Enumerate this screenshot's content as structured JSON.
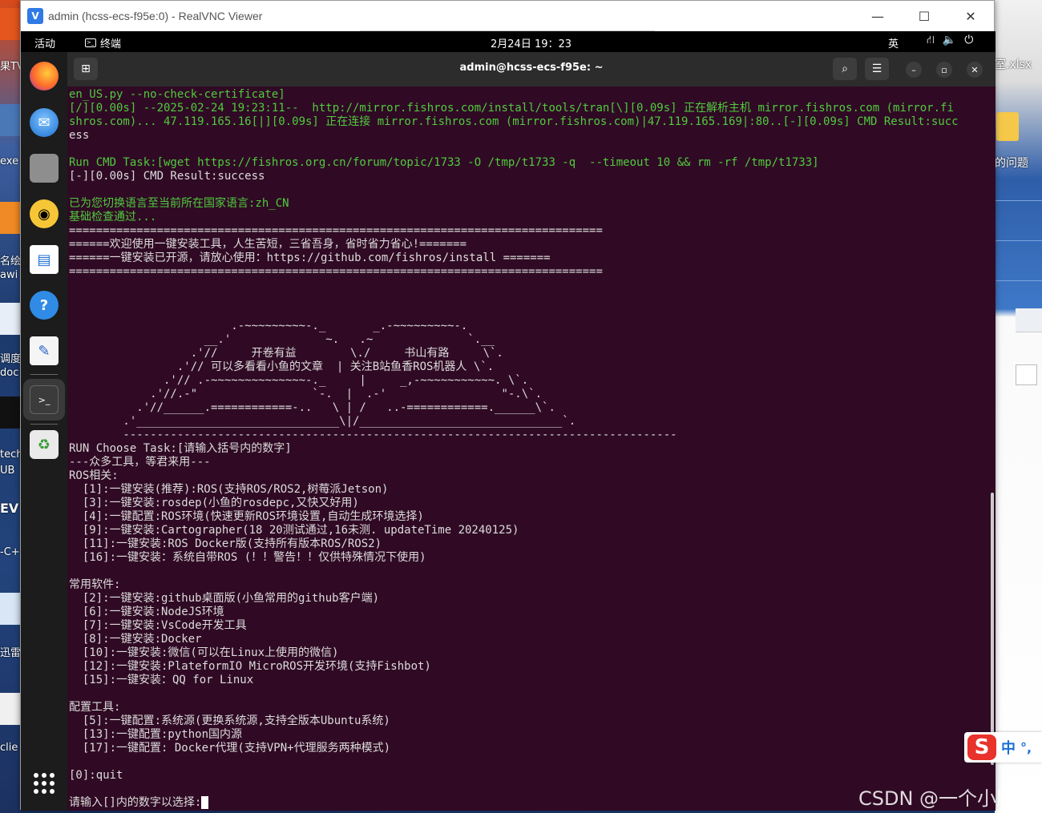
{
  "window": {
    "title": "admin (hcss-ecs-f95e:0) - RealVNC Viewer",
    "logo_letter": "V"
  },
  "desktop": {
    "left_labels": [
      "果TV",
      "exe",
      "名绘",
      "awi",
      "调度",
      "doc",
      "tech",
      "UB",
      "EV",
      "-C+",
      "迅雷",
      "clie"
    ],
    "right_labels": [
      "室.xlsx",
      "的问题"
    ],
    "ime": {
      "logo": "S",
      "mode": "中",
      "punct": "°,"
    },
    "watermark": "CSDN @一个小脑袋"
  },
  "topbar": {
    "activities": "活动",
    "app": "终端",
    "clock": "2月24日  19：23",
    "lang": "英",
    "icons": [
      "network-icon",
      "volume-icon",
      "power-icon"
    ]
  },
  "terminal": {
    "title": "admin@hcss-ecs-f95e: ~",
    "lines": [
      {
        "t": "en_US.py --no-check-certificate]",
        "c": "g"
      },
      {
        "t": "[/][0.00s] --2025-02-24 19:23:11--  http://mirror.fishros.com/install/tools/tran[\\][0.09s] 正在解析主机 mirror.fishros.com (mirror.fi",
        "c": "g"
      },
      {
        "t": "shros.com)... 47.119.165.16[|][0.09s] 正在连接 mirror.fishros.com (mirror.fishros.com)|47.119.165.169|:80..[-][0.09s] CMD Result:succ",
        "c": "g"
      },
      {
        "t": "ess",
        "c": ""
      },
      {
        "t": "",
        "c": ""
      },
      {
        "t": "Run CMD Task:[wget https://fishros.org.cn/forum/topic/1733 -O /tmp/t1733 -q  --timeout 10 && rm -rf /tmp/t1733]",
        "c": "g"
      },
      {
        "t": "[-][0.00s] CMD Result:success",
        "c": ""
      },
      {
        "t": "",
        "c": ""
      },
      {
        "t": "已为您切换语言至当前所在国家语言:zh_CN",
        "c": "g"
      },
      {
        "t": "基础检查通过...",
        "c": "g"
      },
      {
        "t": "===============================================================================",
        "c": ""
      },
      {
        "t": "======欢迎使用一键安装工具，人生苦短，三省吾身，省时省力省心!=======",
        "c": ""
      },
      {
        "t": "======一键安装已开源，请放心使用：https://github.com/fishros/install =======",
        "c": ""
      },
      {
        "t": "===============================================================================",
        "c": ""
      },
      {
        "t": "",
        "c": ""
      },
      {
        "t": "",
        "c": ""
      },
      {
        "t": "",
        "c": ""
      },
      {
        "t": "                        .-~~~~~~~~~-._       _.-~~~~~~~~~-.",
        "c": ""
      },
      {
        "t": "                    __.'              ~.   .~              `.__",
        "c": ""
      },
      {
        "t": "                  .'//     开卷有益        \\./     书山有路     \\`.",
        "c": ""
      },
      {
        "t": "                .'// 可以多看看小鱼的文章  | 关注B站鱼香ROS机器人 \\`.",
        "c": ""
      },
      {
        "t": "              .'// .-~~~~~~~~~~~~~~-._     |     _,-~~~~~~~~~~~. \\`.",
        "c": ""
      },
      {
        "t": "            .'//.-\"                 `-.  |  .-'                 \"-.\\`.",
        "c": ""
      },
      {
        "t": "          .'//______.============-..   \\ | /   ..-============.______\\`.",
        "c": ""
      },
      {
        "t": "        .'______________________________\\|/______________________________`.",
        "c": ""
      },
      {
        "t": "        ----------------------------------------------------------------------------------",
        "c": ""
      },
      {
        "t": "RUN Choose Task:[请输入括号内的数字]",
        "c": ""
      },
      {
        "t": "---众多工具，等君来用---",
        "c": ""
      },
      {
        "t": "ROS相关:",
        "c": ""
      },
      {
        "t": "  [1]:一键安装(推荐):ROS(支持ROS/ROS2,树莓派Jetson)",
        "c": ""
      },
      {
        "t": "  [3]:一键安装:rosdep(小鱼的rosdepc,又快又好用)",
        "c": ""
      },
      {
        "t": "  [4]:一键配置:ROS环境(快速更新ROS环境设置,自动生成环境选择)",
        "c": ""
      },
      {
        "t": "  [9]:一键安装:Cartographer(18 20测试通过,16未测. updateTime 20240125)",
        "c": ""
      },
      {
        "t": "  [11]:一键安装:ROS Docker版(支持所有版本ROS/ROS2)",
        "c": ""
      },
      {
        "t": "  [16]:一键安装：系统自带ROS (！！警告！！仅供特殊情况下使用)",
        "c": ""
      },
      {
        "t": "",
        "c": ""
      },
      {
        "t": "常用软件:",
        "c": ""
      },
      {
        "t": "  [2]:一键安装:github桌面版(小鱼常用的github客户端)",
        "c": ""
      },
      {
        "t": "  [6]:一键安装:NodeJS环境",
        "c": ""
      },
      {
        "t": "  [7]:一键安装:VsCode开发工具",
        "c": ""
      },
      {
        "t": "  [8]:一键安装:Docker",
        "c": ""
      },
      {
        "t": "  [10]:一键安装:微信(可以在Linux上使用的微信)",
        "c": ""
      },
      {
        "t": "  [12]:一键安装:PlateformIO MicroROS开发环境(支持Fishbot)",
        "c": ""
      },
      {
        "t": "  [15]:一键安装：QQ for Linux",
        "c": ""
      },
      {
        "t": "",
        "c": ""
      },
      {
        "t": "配置工具:",
        "c": ""
      },
      {
        "t": "  [5]:一键配置:系统源(更换系统源,支持全版本Ubuntu系统)",
        "c": ""
      },
      {
        "t": "  [13]:一键配置:python国内源",
        "c": ""
      },
      {
        "t": "  [17]:一键配置: Docker代理(支持VPN+代理服务两种模式)",
        "c": ""
      },
      {
        "t": "",
        "c": ""
      },
      {
        "t": "[0]:quit",
        "c": ""
      }
    ],
    "prompt": "请输入[]内的数字以选择:"
  },
  "dock": {
    "apps": [
      "firefox-icon",
      "thunderbird-icon",
      "files-icon",
      "rhythmbox-icon",
      "writer-icon",
      "help-icon",
      "text-editor-icon",
      "terminal-icon",
      "trash-icon"
    ],
    "show_apps": "show-apps-icon"
  }
}
